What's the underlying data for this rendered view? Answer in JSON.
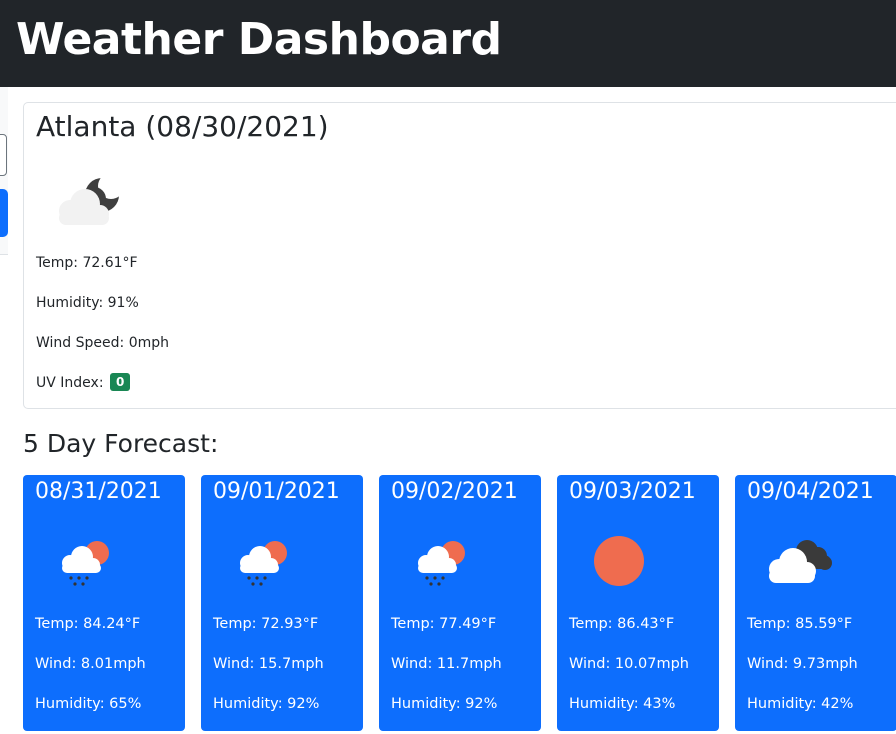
{
  "header": {
    "title": "Weather Dashboard"
  },
  "current": {
    "city_date": "Atlanta (08/30/2021)",
    "icon": "cloudy-night-icon",
    "temp": "Temp: 72.61°F",
    "humidity": "Humidity: 91%",
    "wind": "Wind Speed: 0mph",
    "uv_label": "UV Index:",
    "uv_value": "0",
    "uv_color": "#198754"
  },
  "forecast": {
    "title": "5 Day Forecast:",
    "days": [
      {
        "date": "08/31/2021",
        "icon": "rain-sun-icon",
        "temp": "Temp: 84.24°F",
        "wind": "Wind: 8.01mph",
        "humidity": "Humidity: 65%"
      },
      {
        "date": "09/01/2021",
        "icon": "rain-sun-icon",
        "temp": "Temp: 72.93°F",
        "wind": "Wind: 15.7mph",
        "humidity": "Humidity: 92%"
      },
      {
        "date": "09/02/2021",
        "icon": "rain-sun-icon",
        "temp": "Temp: 77.49°F",
        "wind": "Wind: 11.7mph",
        "humidity": "Humidity: 92%"
      },
      {
        "date": "09/03/2021",
        "icon": "sun-icon",
        "temp": "Temp: 86.43°F",
        "wind": "Wind: 10.07mph",
        "humidity": "Humidity: 43%"
      },
      {
        "date": "09/04/2021",
        "icon": "overcast-clouds-icon",
        "temp": "Temp: 85.59°F",
        "wind": "Wind: 9.73mph",
        "humidity": "Humidity: 42%"
      }
    ]
  },
  "colors": {
    "header_bg": "#212529",
    "card_bg": "#0d6efd",
    "sun": "#ef6c4f"
  }
}
